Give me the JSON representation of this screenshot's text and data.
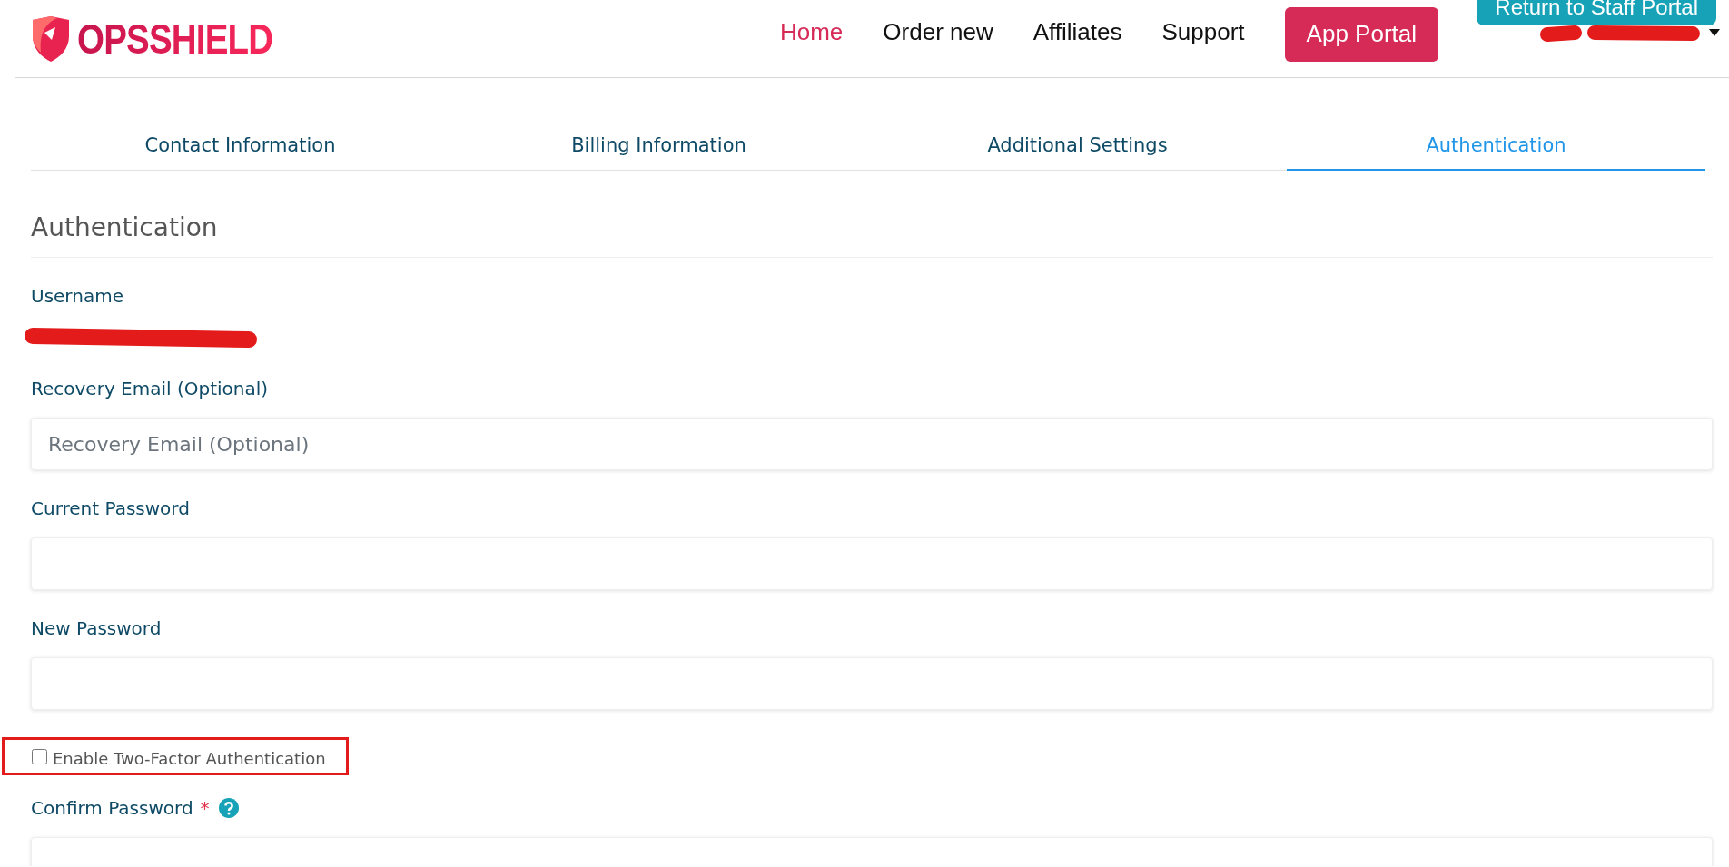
{
  "header": {
    "logo": "OPSSHIELD",
    "nav": [
      {
        "label": "Home",
        "selected": true
      },
      {
        "label": "Order new",
        "selected": false
      },
      {
        "label": "Affiliates",
        "selected": false
      },
      {
        "label": "Support",
        "selected": false
      }
    ],
    "app_button": "App Portal",
    "staff_button": "Return to Staff Portal"
  },
  "tabs": [
    {
      "label": "Contact Information",
      "selected": false
    },
    {
      "label": "Billing Information",
      "selected": false
    },
    {
      "label": "Additional Settings",
      "selected": false
    },
    {
      "label": "Authentication",
      "selected": true
    }
  ],
  "section_title": "Authentication",
  "fields": [
    {
      "kind": "static",
      "label": "Username"
    },
    {
      "kind": "input",
      "label": "Recovery Email (Optional)",
      "placeholder": "Recovery Email (Optional)"
    },
    {
      "kind": "input",
      "label": "Current Password"
    },
    {
      "kind": "input",
      "label": "New Password"
    },
    {
      "kind": "checkbox",
      "label": "Enable Two-Factor Authentication",
      "checked": false,
      "highlighted": true
    },
    {
      "kind": "input",
      "label": "Confirm Password",
      "required": "*",
      "help": true
    }
  ]
}
